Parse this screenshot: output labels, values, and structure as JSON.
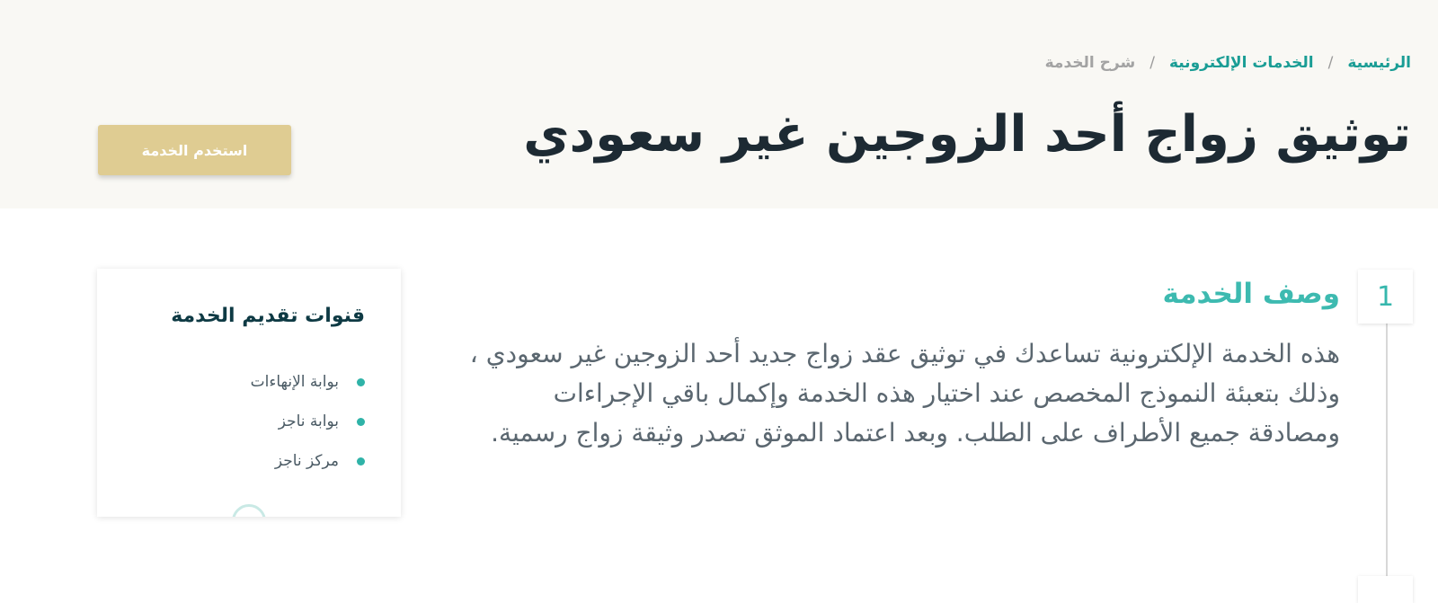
{
  "breadcrumb": {
    "home": "الرئيسية",
    "separator": "/",
    "eservices": "الخدمات الإلكترونية",
    "current": "شرح الخدمة"
  },
  "header": {
    "title": "توثيق زواج أحد الزوجين غير سعودي",
    "use_service_label": "استخدم الخدمة"
  },
  "steps": [
    {
      "number": "1",
      "title": "وصف الخدمة",
      "description": "هذه الخدمة الإلكترونية تساعدك في توثيق عقد زواج جديد أحد الزوجين غير سعودي ، وذلك بتعبئة النموذج المخصص عند اختيار هذه الخدمة وإكمال باقي الإجراءات ومصادقة جميع الأطراف على الطلب. وبعد اعتماد الموثق تصدر وثيقة زواج رسمية."
    }
  ],
  "channels": {
    "title": "قنوات تقديم الخدمة",
    "items": [
      "بوابة الإنهاءات",
      "بوابة ناجز",
      "مركز ناجز"
    ]
  },
  "colors": {
    "accent_teal": "#36b7ad",
    "button_gold": "#dfcc92",
    "header_bg": "#f9f8f4",
    "title_dark": "#1d2a33"
  }
}
